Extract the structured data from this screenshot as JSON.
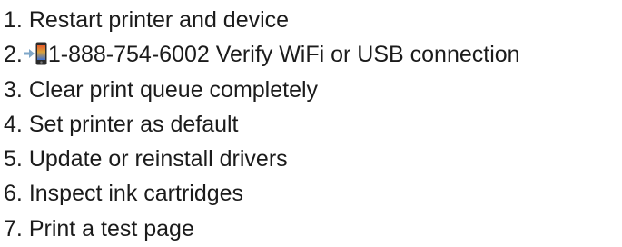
{
  "steps": [
    {
      "number": "1.",
      "text": "Restart printer and device"
    },
    {
      "number": "2.",
      "phone": "1-888-754-6002",
      "text": "Verify WiFi or USB connection",
      "icons": [
        "arrow-right-icon",
        "mobile-phone-icon"
      ]
    },
    {
      "number": "3.",
      "text": "Clear print queue completely"
    },
    {
      "number": "4.",
      "text": "Set printer as default"
    },
    {
      "number": "5.",
      "text": "Update or reinstall drivers"
    },
    {
      "number": "6.",
      "text": "Inspect ink cartridges"
    },
    {
      "number": "7.",
      "text": "Print a test page"
    }
  ],
  "colors": {
    "text": "#1b1b1b",
    "arrow": "#7fa7c8",
    "phone_body": "#2b2b2b",
    "phone_screen_top": "#e85a2a",
    "phone_screen_bottom": "#3a6fd1"
  }
}
